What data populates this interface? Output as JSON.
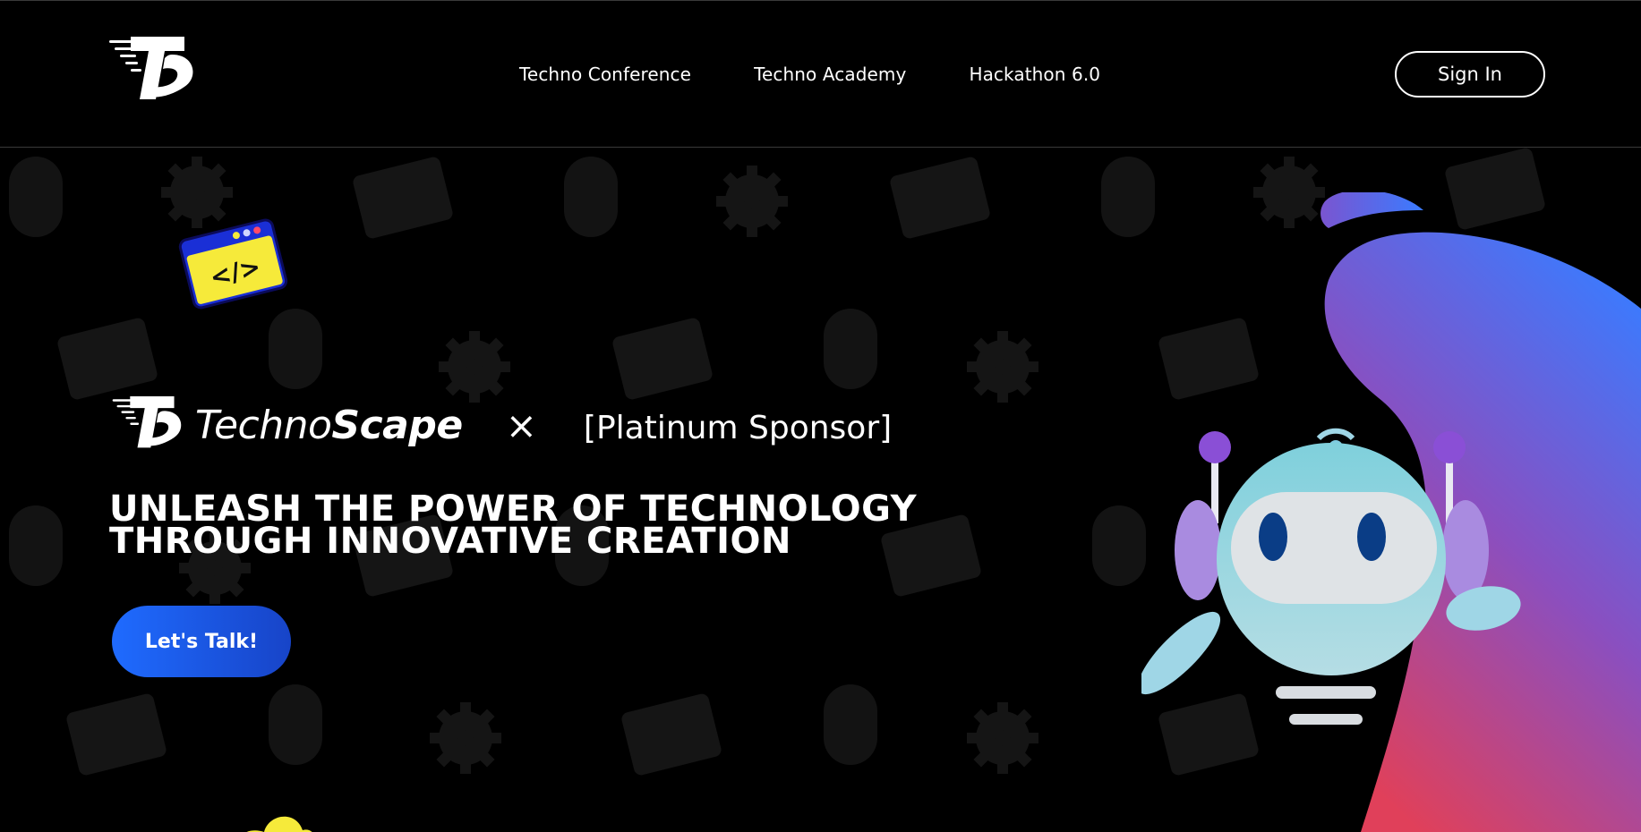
{
  "nav": {
    "logo_icon": "technoscape-ts-logo-icon",
    "links": [
      "Techno Conference",
      "Techno Academy",
      "Hackathon 6.0"
    ],
    "signin_label": "Sign In"
  },
  "hero": {
    "brand_light": "Techno",
    "brand_bold": "Scape",
    "collab_mark": "×",
    "sponsor_text": "[Platinum Sponsor]",
    "headline_line1": "UNLEASH THE POWER OF TECHNOLOGY",
    "headline_line2": "THROUGH INNOVATIVE CREATION",
    "cta_label": "Let's Talk!",
    "code_sticker_text": "</>",
    "colors": {
      "accent_blue": "#1f6bff",
      "blob_top": "#3a7bff",
      "blob_mid": "#8a4fc0",
      "blob_bottom": "#e0405a",
      "sticker_yellow": "#f6ea3a",
      "sticker_blue": "#1a2fd6",
      "robot_body": "#8fd3df",
      "robot_ears": "#a98be0"
    }
  }
}
